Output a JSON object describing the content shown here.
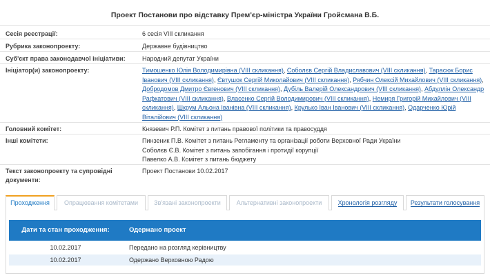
{
  "page_title": "Проект Постанови про відставку Прем'єр-міністра України Гройсмана В.Б.",
  "fields": {
    "session": {
      "label": "Сесія реєстрації:",
      "value": "6 сесія VIII скликання"
    },
    "rubric": {
      "label": "Рубрика законопроекту:",
      "value": "Державне будівництво"
    },
    "subject": {
      "label": "Суб'єкт права законодавчої ініціативи:",
      "value": "Народний депутат України"
    },
    "initiators": {
      "label": "Ініціатор(и) законопроекту:",
      "items": [
        "Тимошенко Юлія Володимирівна (VIII скликання)",
        "Соболєв Сергій Владиславович (VIII скликання)",
        "Тарасюк Борис Іванович (VIII скликання)",
        "Євтушок Сергій Миколайович (VIII скликання)",
        "Рябчин Олексій Михайлович (VIII скликання)",
        "Добродомов Дмитро Євгенович (VIII скликання)",
        "Дубіль Валерій Олександрович (VIII скликання)",
        "Абдуллін Олександр Рафкатович (VIII скликання)",
        "Власенко Сергій Володимирович (VIII скликання)",
        "Немиря Григорій Михайлович (VIII скликання)",
        "Шкрум Альона Іванівна (VIII скликання)",
        "Крулько Іван Іванович (VIII скликання)",
        "Одарченко Юрій Віталійович (VIII скликання)"
      ]
    },
    "main_committee": {
      "label": "Головний комітет:",
      "value": "Князевич Р.П. Комітет з питань правової політики та правосуддя"
    },
    "other_committees": {
      "label": "Інші комітети:",
      "items": [
        "Пинзеник П.В. Комітет з питань Регламенту та організації роботи Верховної Ради України",
        "Соболєв Є.В. Комітет з питань запобігання і протидії корупції",
        "Павелко А.В. Комітет з питань бюджету"
      ]
    },
    "text": {
      "label": "Текст законопроекту та супровідні документи:",
      "value": "Проект Постанови 10.02.2017"
    }
  },
  "tabs": [
    {
      "label": "Проходження",
      "state": "active"
    },
    {
      "label": "Опрацювання комітетами",
      "state": "disabled"
    },
    {
      "label": "Зв'язані законопроекти",
      "state": "disabled"
    },
    {
      "label": "Альтернативні законопроекти",
      "state": "disabled"
    },
    {
      "label": "Хронологія розгляду",
      "state": "normal"
    },
    {
      "label": "Результати голосування",
      "state": "normal"
    }
  ],
  "table": {
    "header_date": "Дати та стан проходження:",
    "header_status": "Одержано проект",
    "rows": [
      {
        "date": "10.02.2017",
        "status": "Передано на розгляд керівництву"
      },
      {
        "date": "10.02.2017",
        "status": "Одержано Верховною Радою"
      }
    ]
  },
  "colors": {
    "accent": "#1f7ac4",
    "link": "#1f5fa6",
    "tab_active_top": "#f0a020",
    "row_alt": "#e8f1fa"
  }
}
